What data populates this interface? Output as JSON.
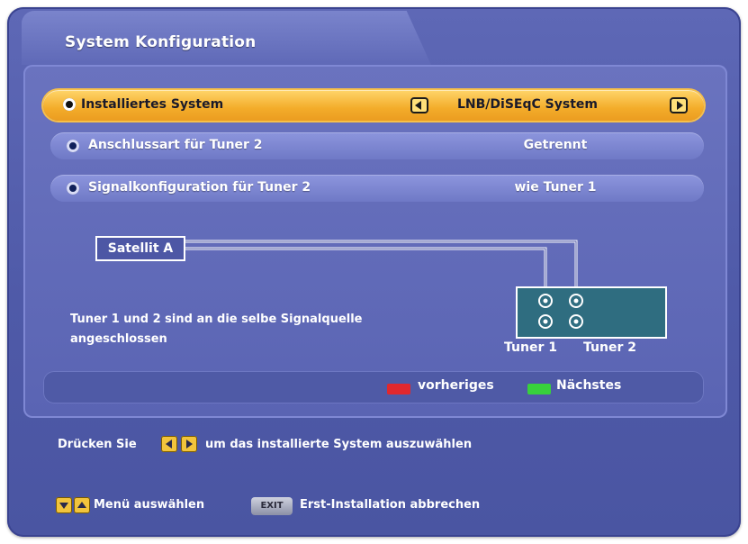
{
  "window": {
    "title": "System Konfiguration"
  },
  "settings": [
    {
      "label": "Installiertes System",
      "value": "LNB/DiSEqC System",
      "selected": true
    },
    {
      "label": "Anschlussart für Tuner 2",
      "value": "Getrennt",
      "selected": false
    },
    {
      "label": "Signalkonfiguration für Tuner 2",
      "value": "wie Tuner 1",
      "selected": false
    }
  ],
  "diagram": {
    "satellite_label": "Satellit A",
    "tuner1_label": "Tuner 1",
    "tuner2_label": "Tuner 2",
    "info_line1": "Tuner 1 und 2 sind an die selbe Signalquelle",
    "info_line2": "angeschlossen"
  },
  "legend": {
    "prev_label": "vorheriges",
    "next_label": "Nächstes",
    "prev_color": "#e0282e",
    "next_color": "#38d13c"
  },
  "help": {
    "line1_prefix": "Drücken Sie",
    "line1_suffix": "um das installierte System auszuwählen",
    "menu_select": "Menü auswählen",
    "exit_key": "EXIT",
    "exit_text": "Erst-Installation abbrechen"
  },
  "colors": {
    "background": "#5460ad",
    "selected_row": "#f3ac2a",
    "row": "#7c86d2"
  }
}
